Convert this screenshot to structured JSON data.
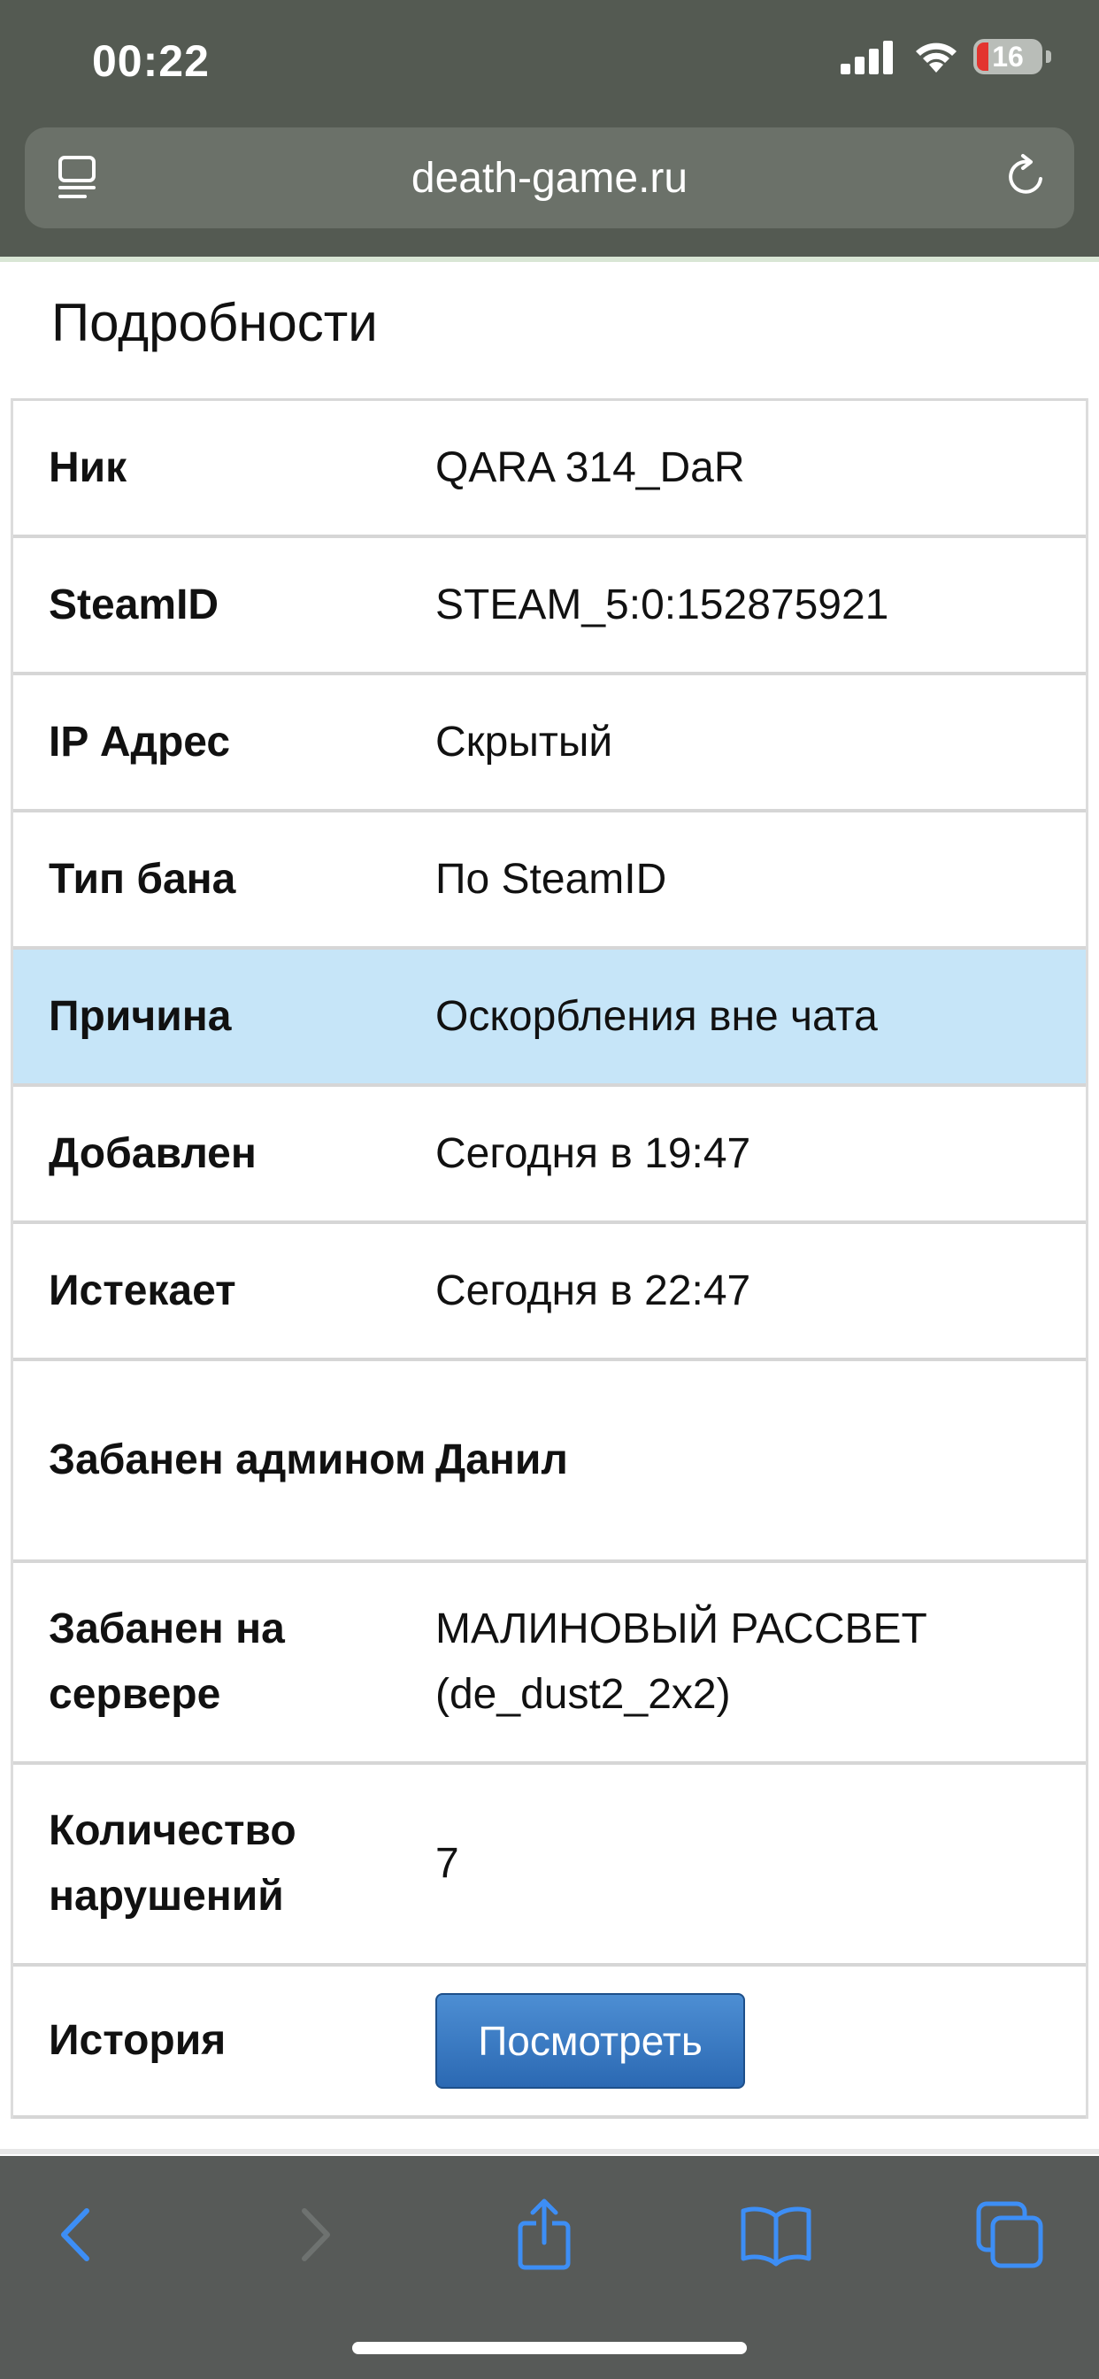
{
  "status_bar": {
    "time": "00:22",
    "battery_level": "16",
    "icons": [
      "signal-icon",
      "wifi-icon",
      "battery-icon"
    ]
  },
  "browser": {
    "url": "death-game.ru",
    "icons": [
      "reader-icon",
      "reload-icon"
    ],
    "toolbar": [
      "back-icon",
      "forward-icon",
      "share-icon",
      "bookmarks-icon",
      "tabs-icon"
    ]
  },
  "page": {
    "title": "Подробности",
    "rows": [
      {
        "label": "Ник",
        "value": "QARA 314_DaR"
      },
      {
        "label": "SteamID",
        "value": "STEAM_5:0:152875921"
      },
      {
        "label": "IP Адрес",
        "value": "Скрытый"
      },
      {
        "label": "Тип бана",
        "value": "По SteamID"
      },
      {
        "label": "Причина",
        "value": "Оскорбления вне чата"
      },
      {
        "label": "Добавлен",
        "value": "Сегодня в 19:47"
      },
      {
        "label": "Истекает",
        "value": "Сегодня в 22:47"
      },
      {
        "label": "Забанен админом",
        "value": "Данил"
      },
      {
        "label": "Забанен на сервере",
        "value": "МАЛИНОВЫЙ РАССВЕТ (de_dust2_2x2)"
      },
      {
        "label": "Количество нарушений",
        "value": "7"
      },
      {
        "label": "История",
        "button": "Посмотреть"
      }
    ]
  },
  "colors": {
    "chrome": "#545a52",
    "highlight_row": "#c6e5f8",
    "button": "#3b7cc4",
    "accent_icons": "#3d8ef5"
  }
}
